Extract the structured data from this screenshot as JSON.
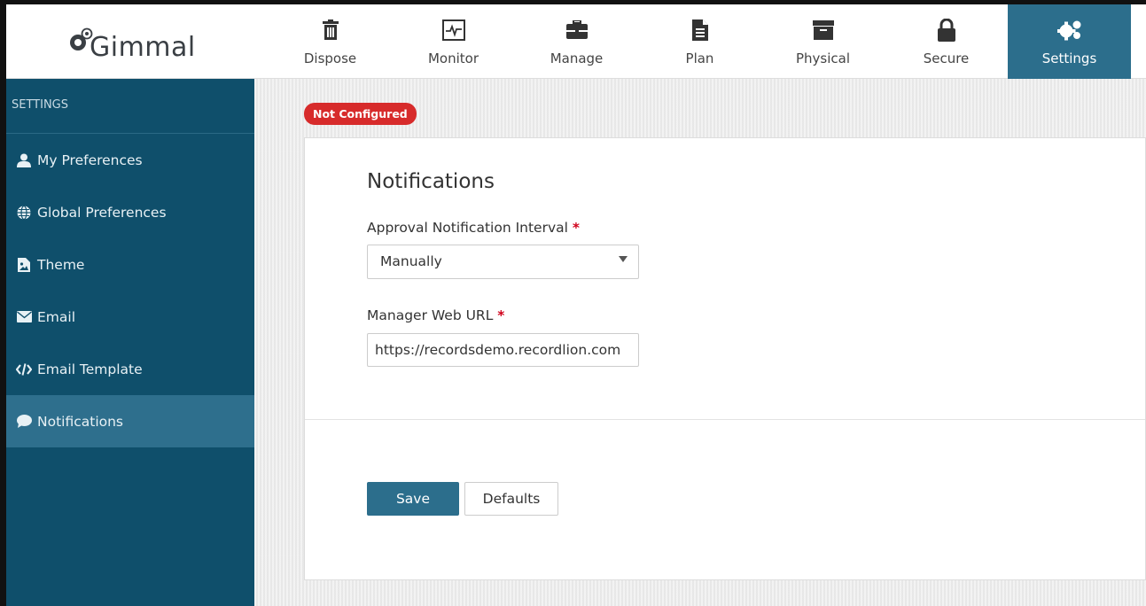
{
  "brand": {
    "name": "Gimmal"
  },
  "nav": {
    "items": [
      {
        "label": "Dispose",
        "icon": "trash-icon"
      },
      {
        "label": "Monitor",
        "icon": "monitor-icon"
      },
      {
        "label": "Manage",
        "icon": "briefcase-icon"
      },
      {
        "label": "Plan",
        "icon": "document-icon"
      },
      {
        "label": "Physical",
        "icon": "archive-box-icon"
      },
      {
        "label": "Secure",
        "icon": "lock-icon"
      },
      {
        "label": "Settings",
        "icon": "gears-icon",
        "active": true
      }
    ]
  },
  "sidebar": {
    "header": "SETTINGS",
    "items": [
      {
        "label": "My Preferences",
        "icon": "user-icon"
      },
      {
        "label": "Global Preferences",
        "icon": "globe-icon"
      },
      {
        "label": "Theme",
        "icon": "image-file-icon"
      },
      {
        "label": "Email",
        "icon": "envelope-icon"
      },
      {
        "label": "Email Template",
        "icon": "code-icon"
      },
      {
        "label": "Notifications",
        "icon": "comment-icon",
        "active": true
      }
    ]
  },
  "status_badge": "Not Configured",
  "form": {
    "title": "Notifications",
    "interval_label": "Approval Notification Interval",
    "interval_value": "Manually",
    "url_label": "Manager Web URL",
    "url_value": "https://recordsdemo.recordlion.com",
    "required_marker": "*",
    "save_label": "Save",
    "defaults_label": "Defaults"
  },
  "colors": {
    "accent": "#2c6e8c",
    "sidebar_bg": "#0f4f6b",
    "badge_red": "#d72b2b"
  }
}
